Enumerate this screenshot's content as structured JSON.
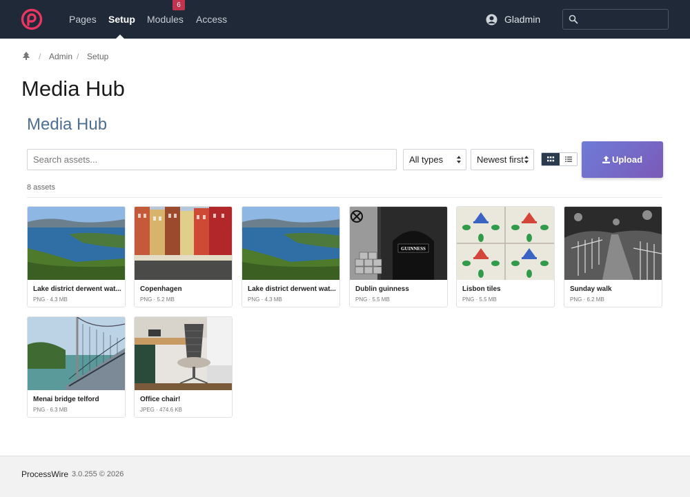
{
  "nav": {
    "items": [
      "Pages",
      "Setup",
      "Modules",
      "Access"
    ],
    "active": "Setup",
    "modules_badge": "6",
    "user_name": "Gladmin",
    "search_placeholder": ""
  },
  "breadcrumb": [
    "Admin",
    "Setup"
  ],
  "breadcrumb_sep": "/",
  "page_title": "Media Hub",
  "section_title": "Media Hub",
  "toolbar": {
    "search_placeholder": "Search assets...",
    "type_filter": "All types",
    "sort": "Newest first",
    "view": "grid",
    "upload_label": "Upload"
  },
  "asset_count": "8 assets",
  "assets": [
    {
      "name": "Lake district derwent wat...",
      "meta": "PNG · 4.3 MB",
      "thumb": "lake"
    },
    {
      "name": "Copenhagen",
      "meta": "PNG · 5.2 MB",
      "thumb": "copenhagen"
    },
    {
      "name": "Lake district derwent wat...",
      "meta": "PNG · 4.3 MB",
      "thumb": "lake"
    },
    {
      "name": "Dublin guinness",
      "meta": "PNG · 5.5 MB",
      "thumb": "guinness"
    },
    {
      "name": "Lisbon tiles",
      "meta": "PNG · 5.5 MB",
      "thumb": "tiles"
    },
    {
      "name": "Sunday walk",
      "meta": "PNG · 6.2 MB",
      "thumb": "walk"
    },
    {
      "name": "Menai bridge telford",
      "meta": "PNG · 6.3 MB",
      "thumb": "bridge"
    },
    {
      "name": "Office chair!",
      "meta": "JPEG · 474.6 KB",
      "thumb": "chair"
    }
  ],
  "guinness_sign": "GUINNESS",
  "footer": {
    "brand": "ProcessWire",
    "version": "3.0.255 © 2026"
  },
  "colors": {
    "nav_bg": "#1f2937",
    "brand_pink": "#e83561",
    "section_title": "#4e6e94",
    "upload_start": "#6f7bd8",
    "upload_end": "#7b5ab8",
    "badge": "#c2334d"
  },
  "icons": {
    "logo": "processwire-logo-icon",
    "user": "user-circle-icon",
    "search": "search-icon",
    "home": "tree-icon",
    "grid": "grid-view-icon",
    "list": "list-view-icon",
    "upload": "upload-icon"
  }
}
